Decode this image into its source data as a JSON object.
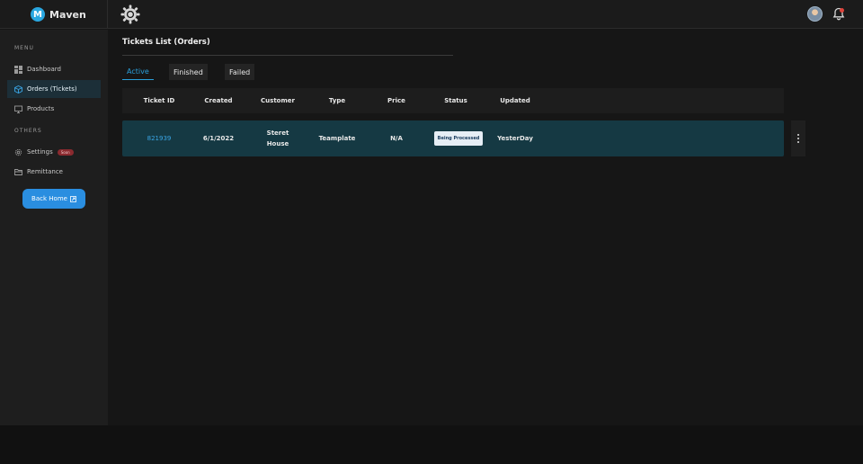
{
  "app": {
    "logo_letter": "M",
    "name": "Maven"
  },
  "sidebar": {
    "menu_label": "MENU",
    "others_label": "OTHERS",
    "items": [
      {
        "label": "Dashboard",
        "icon": "grid-icon"
      },
      {
        "label": "Orders (Tickets)",
        "icon": "box-icon"
      },
      {
        "label": "Products",
        "icon": "monitor-icon"
      }
    ],
    "other_items": [
      {
        "label": "Settings",
        "icon": "gear-icon",
        "badge": "Soon"
      },
      {
        "label": "Remittance",
        "icon": "folder-icon"
      }
    ],
    "back_home": "Back Home"
  },
  "page": {
    "title": "Tickets List (Orders)"
  },
  "tabs": [
    {
      "label": "Active"
    },
    {
      "label": "Finished"
    },
    {
      "label": "Failed"
    }
  ],
  "table": {
    "columns": [
      "Ticket ID",
      "Created",
      "Customer",
      "Type",
      "Price",
      "Status",
      "Updated"
    ],
    "rows": [
      {
        "ticket_id": "821939",
        "created": "6/1/2022",
        "customer_line1": "Steret",
        "customer_line2": "House",
        "type": "Teamplate",
        "price": "N/A",
        "status": "Being Processed",
        "updated": "YesterDay"
      }
    ]
  },
  "colors": {
    "accent": "#2a9fdb",
    "row_bg": "#153943",
    "badge_soon": "#8b2a2f"
  }
}
